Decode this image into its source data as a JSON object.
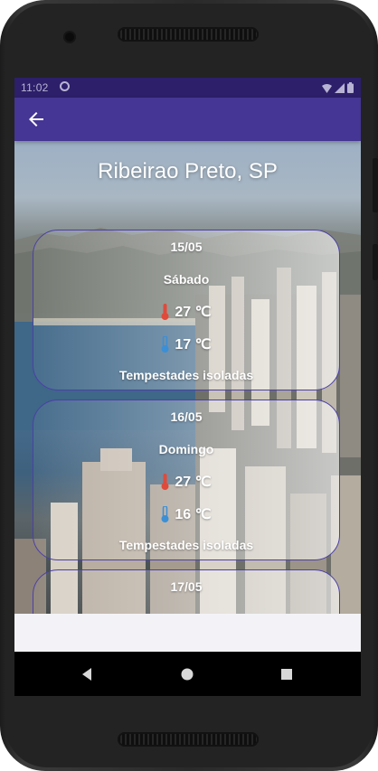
{
  "status_bar": {
    "time": "11:02"
  },
  "header": {
    "city": "Ribeirao Preto, SP"
  },
  "forecast": [
    {
      "date": "15/05",
      "weekday": "Sábado",
      "max": "27 ℃",
      "min": "17 ℃",
      "condition": "Tempestades isoladas"
    },
    {
      "date": "16/05",
      "weekday": "Domingo",
      "max": "27 ℃",
      "min": "16 ℃",
      "condition": "Tempestades isoladas"
    },
    {
      "date": "17/05",
      "weekday": "",
      "max": "",
      "min": "",
      "condition": ""
    }
  ],
  "colors": {
    "app_bar": "#453594",
    "status_bar": "#2d1f6a",
    "card_border": "#4b3fa8",
    "hot_icon": "#e04a3a",
    "cold_icon": "#3b8fd6"
  },
  "icons": {
    "back": "arrow-left-icon",
    "hot": "thermometer-hot-icon",
    "cold": "thermometer-cold-icon"
  }
}
